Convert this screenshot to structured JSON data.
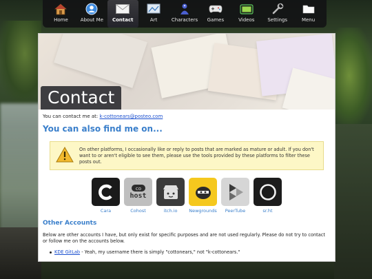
{
  "nav": {
    "items": [
      {
        "label": "Home",
        "icon": "home-icon"
      },
      {
        "label": "About Me",
        "icon": "person-icon"
      },
      {
        "label": "Contact",
        "icon": "envelope-icon",
        "active": true
      },
      {
        "label": "Art",
        "icon": "art-icon"
      },
      {
        "label": "Characters",
        "icon": "character-icon"
      },
      {
        "label": "Games",
        "icon": "gamepad-icon"
      },
      {
        "label": "Videos",
        "icon": "video-icon"
      },
      {
        "label": "Settings",
        "icon": "wrench-icon"
      },
      {
        "label": "Menu",
        "icon": "folder-icon"
      }
    ]
  },
  "page": {
    "title": "Contact",
    "contact_prefix": "You can contact me at: ",
    "contact_email": "k-cottonears@posteo.com",
    "find_heading": "You can also find me on...",
    "warning_text": "On other platforms, I occasionally like or reply to posts that are marked as mature or adult. If you don't want to or aren't eligible to see them, please use the tools provided by these platforms to filter these posts out.",
    "platforms": [
      {
        "label": "Cara",
        "icon": "cara-icon"
      },
      {
        "label": "Cohost",
        "icon": "cohost-icon",
        "logo_text": "host"
      },
      {
        "label": "itch.io",
        "icon": "itchio-icon"
      },
      {
        "label": "Newgrounds",
        "icon": "newgrounds-icon"
      },
      {
        "label": "PeerTube",
        "icon": "peertube-icon"
      },
      {
        "label": "sr.ht",
        "icon": "srht-icon"
      }
    ],
    "other_heading": "Other Accounts",
    "other_text": "Below are other accounts I have, but only exist for specific purposes and are not used regularly. Please do not try to contact or follow me on the accounts below.",
    "other_link": "KDE GitLab",
    "other_link_desc": " - Yeah, my username there is simply \"cottonears,\" not \"k-cottonears.\""
  },
  "colors": {
    "accent": "#3a7fcb",
    "link": "#1a4fcf",
    "warning_bg": "#fdf7c6",
    "nav_bg": "#121214"
  }
}
